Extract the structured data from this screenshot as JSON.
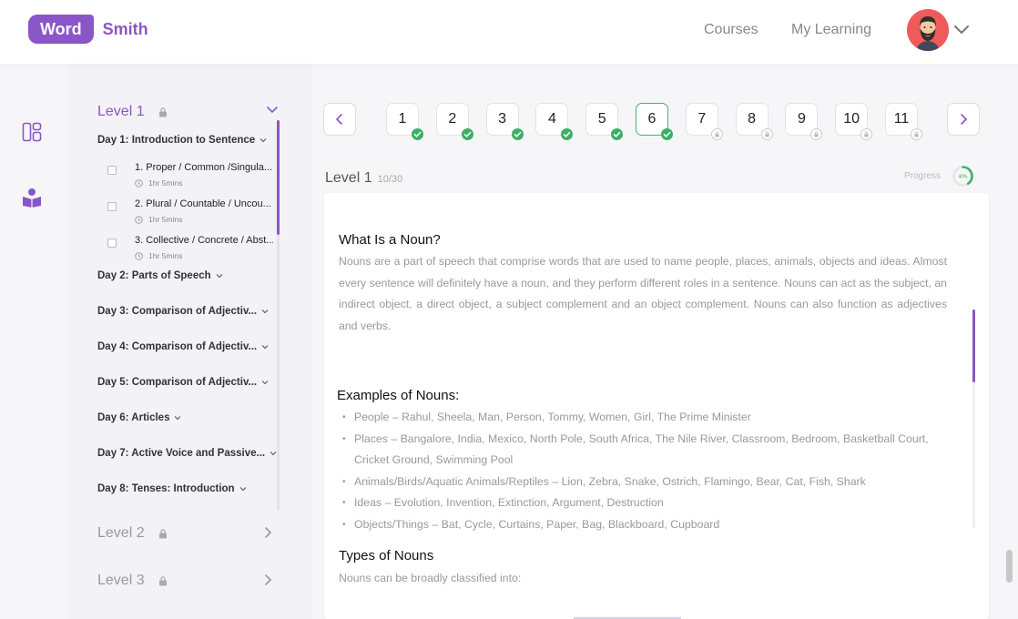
{
  "brand": {
    "word": "Word",
    "smith": "Smith"
  },
  "nav": {
    "courses": "Courses",
    "my_learning": "My Learning"
  },
  "sidebar": {
    "level1": {
      "title": "Level 1",
      "days": [
        "Day 1: Introduction to Sentence",
        "Day 2: Parts of Speech",
        "Day 3: Comparison of Adjectiv...",
        "Day 4: Comparison of Adjectiv...",
        "Day 5: Comparison of Adjectiv...",
        "Day 6: Articles",
        "Day 7: Active Voice and Passive...",
        "Day 8: Tenses: Introduction"
      ],
      "lessons": [
        {
          "title": "1. Proper / Common /Singula...",
          "time": "1hr 5mins"
        },
        {
          "title": "2. Plural / Countable / Uncou...",
          "time": "1hr 5mins"
        },
        {
          "title": "3. Collective / Concrete / Abst...",
          "time": "1hr 5mins"
        }
      ]
    },
    "level2": {
      "title": "Level 2"
    },
    "level3": {
      "title": "Level 3"
    }
  },
  "pager": {
    "days": [
      "1",
      "2",
      "3",
      "4",
      "5",
      "6",
      "7",
      "8",
      "9",
      "10",
      "11"
    ],
    "completed": 6,
    "current": "6"
  },
  "main": {
    "level_title": "Level 1",
    "level_count": "10/30",
    "progress_label": "Progress",
    "progress_value": "40%",
    "progress_fraction": 0.4
  },
  "content": {
    "heading1": "What Is a Noun?",
    "para1": "Nouns are a part of speech that comprise words that are used to name people, places, animals, objects and ideas. Almost every sentence will definitely have a noun, and they perform different roles in a sentence. Nouns can act as the subject, an indirect object, a direct object, a subject complement and an object complement. Nouns can also function as adjectives and verbs.",
    "heading2": "Examples of Nouns:",
    "examples": [
      "People – Rahul, Sheela, Man, Person, Tommy, Women, Girl, The Prime Minister",
      "Places – Bangalore, India, Mexico, North Pole, South Africa, The Nile River, Classroom, Bedroom, Basketball Court, Cricket Ground, Swimming Pool",
      "Animals/Birds/Aquatic Animals/Reptiles – Lion, Zebra, Snake, Ostrich, Flamingo, Bear, Cat, Fish, Shark",
      "Ideas – Evolution, Invention, Extinction, Argument, Destruction",
      "Objects/Things – Bat, Cycle, Curtains, Paper, Bag, Blackboard, Cupboard"
    ],
    "heading3": "Types of Nouns",
    "para3": "Nouns can be broadly classified into:"
  },
  "colors": {
    "accent": "#8a55c7",
    "success": "#3cb063"
  }
}
